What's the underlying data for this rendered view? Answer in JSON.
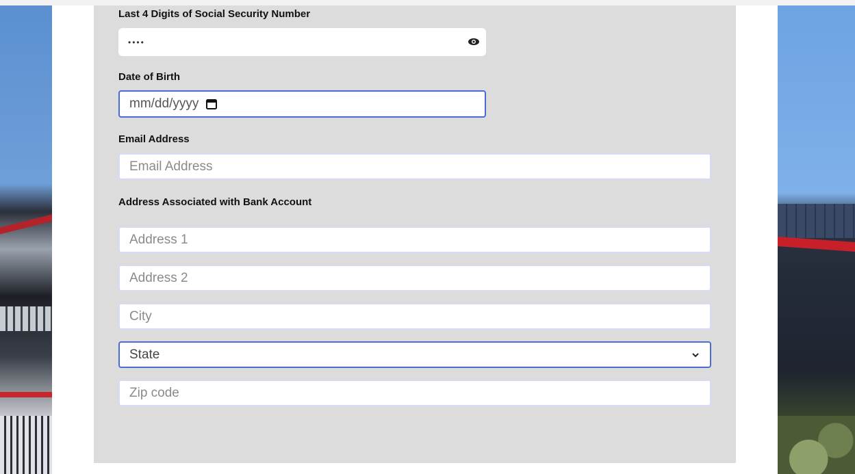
{
  "form": {
    "ssn": {
      "label": "Last 4 Digits of Social Security Number",
      "value": "••••",
      "toggle_icon": "eye-icon"
    },
    "dob": {
      "label": "Date of Birth",
      "placeholder": "mm/dd/yyyy",
      "picker_icon": "calendar-icon"
    },
    "email": {
      "label": "Email Address",
      "placeholder": "Email Address"
    },
    "address": {
      "label": "Address Associated with Bank Account",
      "address1_placeholder": "Address 1",
      "address2_placeholder": "Address 2",
      "city_placeholder": "City",
      "state_selected": "State",
      "zip_placeholder": "Zip code"
    }
  },
  "colors": {
    "panel": "#dcdcdc",
    "field_border": "#d4daf7",
    "focus_border": "#4a6bd6"
  }
}
